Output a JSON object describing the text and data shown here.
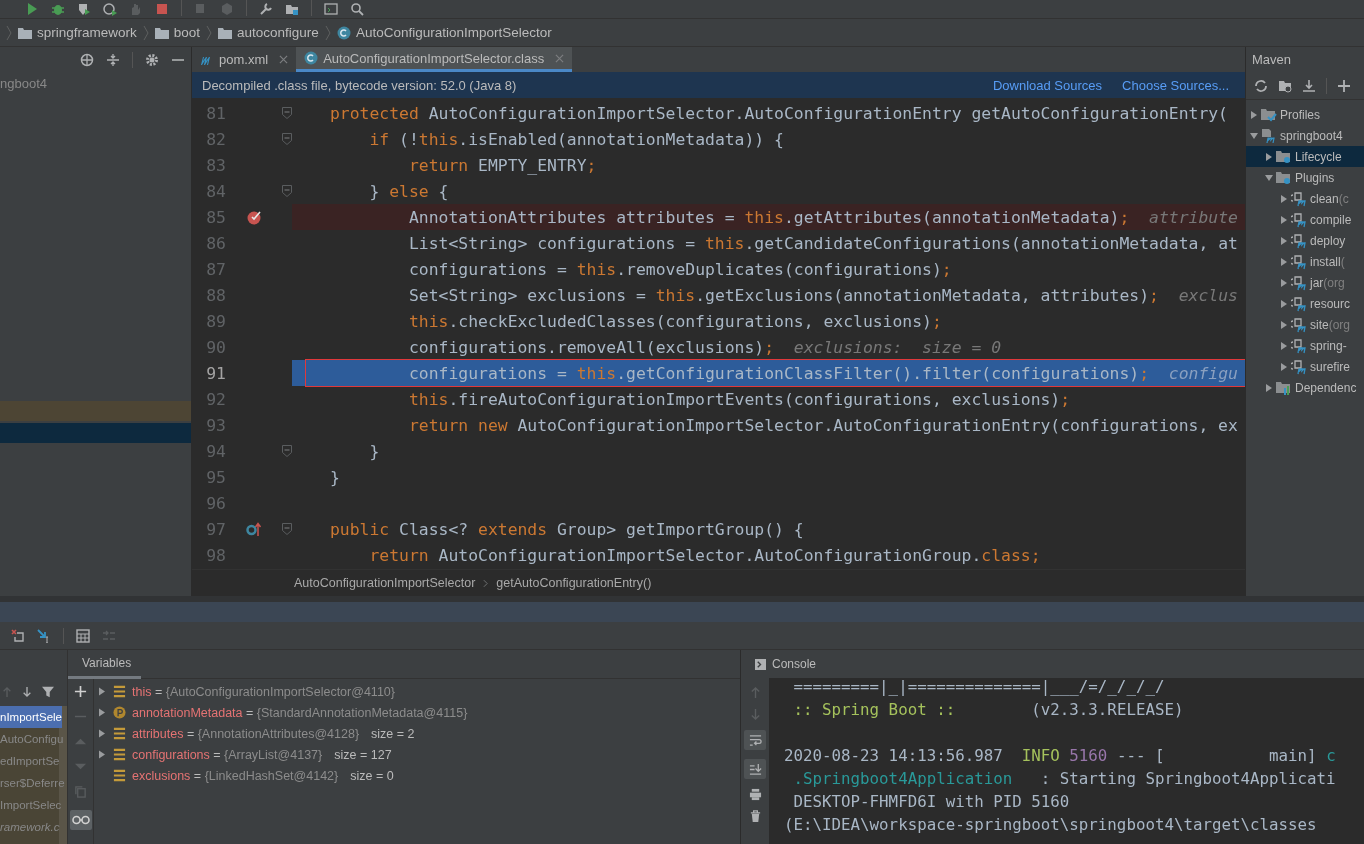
{
  "breadcrumb": [
    {
      "label": "springframework",
      "kind": "folder"
    },
    {
      "label": "boot",
      "kind": "folder"
    },
    {
      "label": "autoconfigure",
      "kind": "folder"
    },
    {
      "label": "AutoConfigurationImportSelector",
      "kind": "class"
    }
  ],
  "project_panel": {
    "title": "ngboot4"
  },
  "editor_tabs": [
    {
      "label": "pom.xml",
      "kind": "maven",
      "selected": false
    },
    {
      "label": "AutoConfigurationImportSelector.class",
      "kind": "class",
      "selected": true
    }
  ],
  "banner": {
    "text": "Decompiled .class file, bytecode version: 52.0 (Java 8)",
    "links": [
      "Download Sources",
      "Choose Sources..."
    ]
  },
  "code_lines": [
    {
      "number": "81",
      "fold": true,
      "tokens": [
        {
          "kind": "keyword",
          "text": "protected"
        },
        {
          "kind": "plain",
          "text": " AutoConfigurationImportSelector.AutoConfigurationEntry getAutoConfigurationEntry("
        }
      ]
    },
    {
      "number": "82",
      "fold": true,
      "tokens": [
        {
          "kind": "keyword",
          "text": "    if"
        },
        {
          "kind": "plain",
          "text": " (!"
        },
        {
          "kind": "keyword",
          "text": "this"
        },
        {
          "kind": "plain",
          "text": ".isEnabled(annotationMetadata)) {"
        }
      ]
    },
    {
      "number": "83",
      "tokens": [
        {
          "kind": "keyword",
          "text": "        return"
        },
        {
          "kind": "plain",
          "text": " EMPTY_ENTRY"
        },
        {
          "kind": "keyword",
          "text": ";"
        }
      ]
    },
    {
      "number": "84",
      "fold": true,
      "tokens": [
        {
          "kind": "plain",
          "text": "    } "
        },
        {
          "kind": "keyword",
          "text": "else"
        },
        {
          "kind": "plain",
          "text": " {"
        }
      ]
    },
    {
      "number": "85",
      "breakpoint": true,
      "tokens": [
        {
          "kind": "plain",
          "text": "        AnnotationAttributes attributes = "
        },
        {
          "kind": "keyword",
          "text": "this"
        },
        {
          "kind": "plain",
          "text": ".getAttributes(annotationMetadata)"
        },
        {
          "kind": "keyword",
          "text": ";"
        },
        {
          "kind": "hint",
          "text": "  attribute"
        }
      ]
    },
    {
      "number": "86",
      "tokens": [
        {
          "kind": "plain",
          "text": "        List<String> configurations = "
        },
        {
          "kind": "keyword",
          "text": "this"
        },
        {
          "kind": "plain",
          "text": ".getCandidateConfigurations(annotationMetadata, at"
        }
      ]
    },
    {
      "number": "87",
      "tokens": [
        {
          "kind": "plain",
          "text": "        configurations = "
        },
        {
          "kind": "keyword",
          "text": "this"
        },
        {
          "kind": "plain",
          "text": ".removeDuplicates(configurations)"
        },
        {
          "kind": "keyword",
          "text": ";"
        }
      ]
    },
    {
      "number": "88",
      "tokens": [
        {
          "kind": "plain",
          "text": "        Set<String> exclusions = "
        },
        {
          "kind": "keyword",
          "text": "this"
        },
        {
          "kind": "plain",
          "text": ".getExclusions(annotationMetadata, attributes)"
        },
        {
          "kind": "keyword",
          "text": ";"
        },
        {
          "kind": "hint",
          "text": "  exclus"
        }
      ]
    },
    {
      "number": "89",
      "tokens": [
        {
          "kind": "keyword",
          "text": "        this"
        },
        {
          "kind": "plain",
          "text": ".checkExcludedClasses(configurations, exclusions)"
        },
        {
          "kind": "keyword",
          "text": ";"
        }
      ]
    },
    {
      "number": "90",
      "tokens": [
        {
          "kind": "plain",
          "text": "        configurations.removeAll(exclusions)"
        },
        {
          "kind": "keyword",
          "text": ";"
        },
        {
          "kind": "hint",
          "text": "  exclusions:  size = 0"
        }
      ]
    },
    {
      "number": "91",
      "current": true,
      "framed": true,
      "tokens": [
        {
          "kind": "plain",
          "text": "        configurations = "
        },
        {
          "kind": "keyword",
          "text": "this"
        },
        {
          "kind": "plain",
          "text": ".getConfigurationClassFilter().filter(configurations)"
        },
        {
          "kind": "keyword",
          "text": ";"
        },
        {
          "kind": "hint",
          "text": "  configu"
        }
      ]
    },
    {
      "number": "92",
      "tokens": [
        {
          "kind": "keyword",
          "text": "        this"
        },
        {
          "kind": "plain",
          "text": ".fireAutoConfigurationImportEvents(configurations, exclusions)"
        },
        {
          "kind": "keyword",
          "text": ";"
        }
      ]
    },
    {
      "number": "93",
      "tokens": [
        {
          "kind": "keyword",
          "text": "        return new"
        },
        {
          "kind": "plain",
          "text": " AutoConfigurationImportSelector.AutoConfigurationEntry(configurations, ex"
        }
      ]
    },
    {
      "number": "94",
      "fold": true,
      "tokens": [
        {
          "kind": "plain",
          "text": "    }"
        }
      ]
    },
    {
      "number": "95",
      "tokens": [
        {
          "kind": "plain",
          "text": "}"
        }
      ]
    },
    {
      "number": "96"
    },
    {
      "number": "97",
      "fold": true,
      "overridden": true,
      "tokens": [
        {
          "kind": "keyword",
          "text": "public"
        },
        {
          "kind": "plain",
          "text": " Class<? "
        },
        {
          "kind": "keyword",
          "text": "extends"
        },
        {
          "kind": "plain",
          "text": " Group> getImportGroup() {"
        }
      ]
    },
    {
      "number": "98",
      "tokens": [
        {
          "kind": "keyword",
          "text": "    return"
        },
        {
          "kind": "plain",
          "text": " AutoConfigurationImportSelector.AutoConfigurationGroup."
        },
        {
          "kind": "keyword",
          "text": "class;"
        }
      ]
    }
  ],
  "code_breadcrumb": [
    "AutoConfigurationImportSelector",
    "getAutoConfigurationEntry()"
  ],
  "maven": {
    "title": "Maven",
    "tree": [
      {
        "label": "Profiles",
        "kind": "profiles",
        "expanded": false,
        "selected": false
      },
      {
        "label": "springboot4",
        "kind": "project",
        "expanded": true,
        "selected": false,
        "children": [
          {
            "label": "Lifecycle",
            "kind": "folder",
            "expanded": false,
            "selected": true
          },
          {
            "label": "Plugins",
            "kind": "folder",
            "expanded": true,
            "selected": false,
            "children": [
              {
                "label": "clean",
                "detail": "(c",
                "kind": "plugin",
                "expanded": false,
                "selected": false
              },
              {
                "label": "compile",
                "kind": "plugin",
                "expanded": false,
                "selected": false
              },
              {
                "label": "deploy",
                "kind": "plugin",
                "expanded": false,
                "selected": false
              },
              {
                "label": "install",
                "detail": "(",
                "kind": "plugin",
                "expanded": false,
                "selected": false
              },
              {
                "label": "jar",
                "detail": "(org",
                "kind": "plugin",
                "expanded": false,
                "selected": false
              },
              {
                "label": "resourc",
                "kind": "plugin",
                "expanded": false,
                "selected": false
              },
              {
                "label": "site",
                "detail": "(org",
                "kind": "plugin",
                "expanded": false,
                "selected": false
              },
              {
                "label": "spring-",
                "kind": "plugin",
                "expanded": false,
                "selected": false
              },
              {
                "label": "surefire",
                "kind": "plugin",
                "expanded": false,
                "selected": false
              }
            ]
          },
          {
            "label": "Dependenc",
            "kind": "deps",
            "expanded": false,
            "selected": false
          }
        ]
      }
    ]
  },
  "debugger": {
    "frames": [
      {
        "label": "nImportSele",
        "selected": true,
        "italic": false
      },
      {
        "label": "AutoConfigu",
        "selected": false,
        "italic": false
      },
      {
        "label": "edImportSe",
        "selected": false,
        "italic": false
      },
      {
        "label": "rser$Deferre",
        "selected": false,
        "italic": false
      },
      {
        "label": "ImportSelec",
        "selected": false,
        "italic": false
      },
      {
        "label": "ramework.c",
        "selected": false,
        "italic": true
      }
    ],
    "variables_tab": "Variables",
    "variables": [
      {
        "name": "this",
        "separator": "=",
        "value": "{AutoConfigurationImportSelector@4110}",
        "kind": "field",
        "expandable": true
      },
      {
        "name": "annotationMetadata",
        "separator": "=",
        "value": "{StandardAnnotationMetadata@4115}",
        "kind": "param",
        "expandable": true
      },
      {
        "name": "attributes",
        "separator": "=",
        "value": "{AnnotationAttributes@4128}",
        "size": "size = 2",
        "kind": "field",
        "expandable": true
      },
      {
        "name": "configurations",
        "separator": "=",
        "value": "{ArrayList@4137}",
        "size": "size = 127",
        "kind": "field",
        "expandable": true
      },
      {
        "name": "exclusions",
        "separator": "=",
        "value": "{LinkedHashSet@4142}",
        "size": "size = 0",
        "kind": "field",
        "expandable": false
      }
    ],
    "console_tab": "Console",
    "console_lines": [
      {
        "segments": [
          {
            "kind": "plain",
            "text": " =========|_|==============|___/=/_/_/_/"
          }
        ]
      },
      {
        "segments": [
          {
            "kind": "banner",
            "text": " :: Spring Boot ::"
          },
          {
            "kind": "plain",
            "text": "        (v2.3.3.RELEASE)"
          }
        ]
      },
      {
        "space_before": true,
        "segments": [
          {
            "kind": "plain",
            "text": "2020-08-23 14:13:56.987  "
          },
          {
            "kind": "level",
            "text": "INFO"
          },
          {
            "kind": "pid",
            "text": " 5160"
          },
          {
            "kind": "plain",
            "text": " --- [           main] "
          },
          {
            "kind": "logger",
            "text": "c"
          }
        ]
      },
      {
        "segments": [
          {
            "kind": "logger",
            "text": " .Springboot4Application"
          },
          {
            "kind": "plain",
            "text": "   : Starting Springboot4Applicati"
          }
        ]
      },
      {
        "segments": [
          {
            "kind": "plain",
            "text": " DESKTOP-FHMFD6I with PID 5160"
          }
        ]
      },
      {
        "segments": [
          {
            "kind": "plain",
            "text": "(E:\\IDEA\\workspace-springboot\\springboot4\\target\\classes"
          }
        ]
      }
    ]
  }
}
